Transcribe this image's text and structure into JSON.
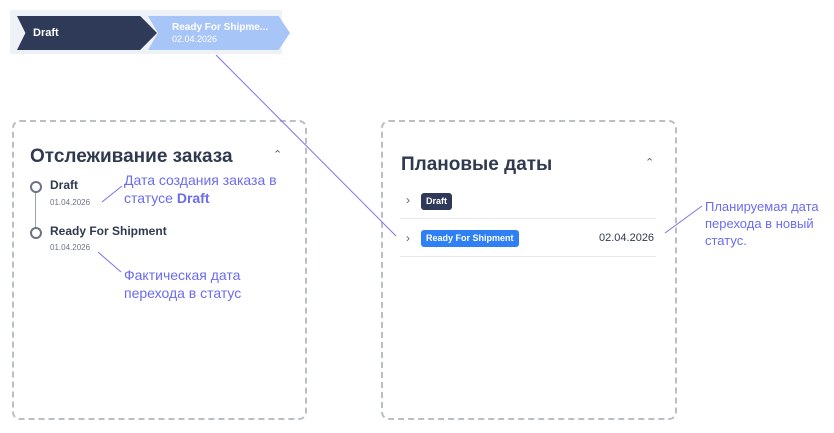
{
  "stepper": {
    "steps": [
      {
        "label": "Draft"
      },
      {
        "label": "Ready For Shipme...",
        "date": "02.04.2026"
      }
    ]
  },
  "tracking": {
    "title": "Отслеживание заказа",
    "items": [
      {
        "title": "Draft",
        "date": "01.04.2026"
      },
      {
        "title": "Ready For Shipment",
        "date": "01.04.2026"
      }
    ]
  },
  "planned": {
    "title": "Плановые даты",
    "rows": [
      {
        "badge": "Draft",
        "date": ""
      },
      {
        "badge": "Ready For Shipment",
        "date": "02.04.2026"
      }
    ]
  },
  "annotations": {
    "creation_line1": "Дата создания заказа в",
    "creation_line2_prefix": "статусе ",
    "creation_status": "Draft",
    "actual_line1": "Фактическая дата",
    "actual_line2": "перехода в статус",
    "planned_line1": "Планируемая дата",
    "planned_line2": "перехода в новый",
    "planned_line3": "статус."
  },
  "colors": {
    "accent": "#2f7ff5",
    "dark": "#2f3a58",
    "annotation": "#6b6bf0",
    "stepper_light": "#a8c5f7"
  },
  "icons": {
    "collapse": "chevron-up-icon",
    "expand": "chevron-right-icon",
    "timeline": "circle-icon"
  }
}
